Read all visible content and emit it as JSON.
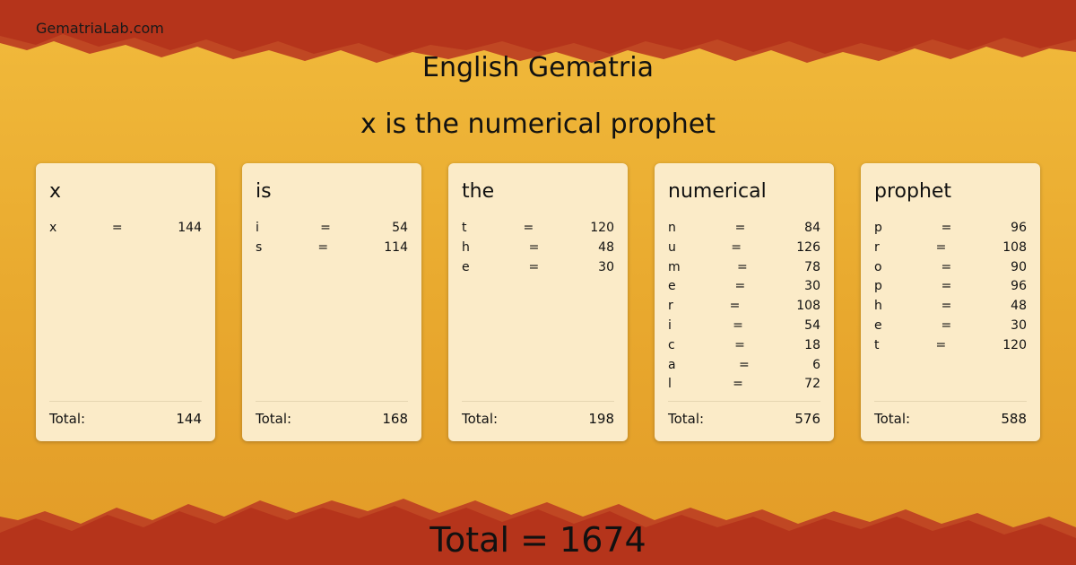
{
  "site": {
    "name": "GematriaLab.com"
  },
  "title": "English Gematria",
  "phrase": "x is the numerical prophet",
  "total_label": "Total:",
  "equals_sign": "=",
  "words": [
    {
      "word": "x",
      "letters": [
        {
          "l": "x",
          "v": "144"
        }
      ],
      "total": "144"
    },
    {
      "word": "is",
      "letters": [
        {
          "l": "i",
          "v": "54"
        },
        {
          "l": "s",
          "v": "114"
        }
      ],
      "total": "168"
    },
    {
      "word": "the",
      "letters": [
        {
          "l": "t",
          "v": "120"
        },
        {
          "l": "h",
          "v": "48"
        },
        {
          "l": "e",
          "v": "30"
        }
      ],
      "total": "198"
    },
    {
      "word": "numerical",
      "letters": [
        {
          "l": "n",
          "v": "84"
        },
        {
          "l": "u",
          "v": "126"
        },
        {
          "l": "m",
          "v": "78"
        },
        {
          "l": "e",
          "v": "30"
        },
        {
          "l": "r",
          "v": "108"
        },
        {
          "l": "i",
          "v": "54"
        },
        {
          "l": "c",
          "v": "18"
        },
        {
          "l": "a",
          "v": "6"
        },
        {
          "l": "l",
          "v": "72"
        }
      ],
      "total": "576"
    },
    {
      "word": "prophet",
      "letters": [
        {
          "l": "p",
          "v": "96"
        },
        {
          "l": "r",
          "v": "108"
        },
        {
          "l": "o",
          "v": "90"
        },
        {
          "l": "p",
          "v": "96"
        },
        {
          "l": "h",
          "v": "48"
        },
        {
          "l": "e",
          "v": "30"
        },
        {
          "l": "t",
          "v": "120"
        }
      ],
      "total": "588"
    }
  ],
  "grand_total": "Total = 1674",
  "colors": {
    "background_top": "#b5341b",
    "background_middle": "#e8a52e",
    "card": "#fbebc8",
    "text": "#111111"
  }
}
